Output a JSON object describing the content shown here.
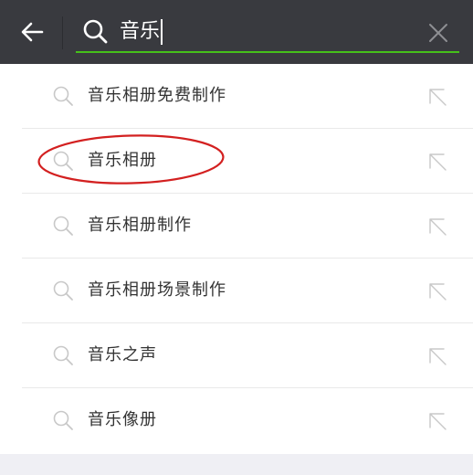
{
  "search": {
    "query": "音乐"
  },
  "suggestions": [
    {
      "label": "音乐相册免费制作"
    },
    {
      "label": "音乐相册"
    },
    {
      "label": "音乐相册制作"
    },
    {
      "label": "音乐相册场景制作"
    },
    {
      "label": "音乐之声"
    },
    {
      "label": "音乐像册"
    }
  ],
  "colors": {
    "topbar": "#393a3f",
    "accent_underline": "#45c01a",
    "highlight_circle": "#d32020",
    "icon_gray": "#c8c8c8",
    "text": "#333333"
  },
  "icons": {
    "back": "arrow-left-icon",
    "search": "search-icon",
    "clear": "close-icon",
    "fill_suggestion": "arrow-up-left-icon"
  }
}
